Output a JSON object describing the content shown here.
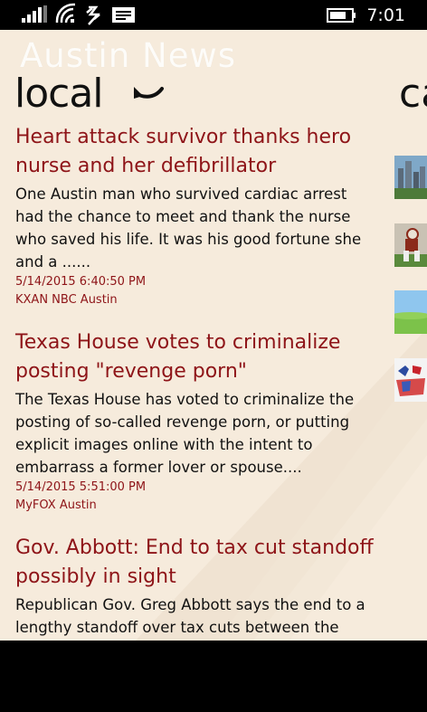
{
  "status_bar": {
    "time": "7:01"
  },
  "app": {
    "name": "Austin News"
  },
  "pivot": {
    "current": "local",
    "next_peek": "ca"
  },
  "articles": [
    {
      "headline": "Heart attack survivor thanks hero nurse and her defibrillator",
      "summary": "One Austin man who survived cardiac arrest had the chance to meet and thank the nurse who saved his life. It was his good fortune she and a ......",
      "date": "5/14/2015 6:40:50 PM",
      "source": "KXAN NBC Austin"
    },
    {
      "headline": "Texas House votes to criminalize posting \"revenge porn\"",
      "summary": "The Texas House has voted to criminalize the posting of so-called revenge porn, or putting explicit images online with the intent to embarrass a former lover or spouse....",
      "date": "5/14/2015 5:51:00 PM",
      "source": "MyFOX Austin"
    },
    {
      "headline": "Gov. Abbott: End to tax cut standoff possibly in sight",
      "summary": "Republican Gov. Greg Abbott says the end to a lengthy standoff over tax cuts between the",
      "date": "",
      "source": ""
    }
  ],
  "thumbnails": [
    {
      "icon": "city-skyline-thumbnail"
    },
    {
      "icon": "football-player-thumbnail"
    },
    {
      "icon": "green-field-thumbnail"
    },
    {
      "icon": "politics-map-thumbnail"
    }
  ],
  "colors": {
    "accent": "#8e1418",
    "background": "#f6ebdc",
    "text": "#111111"
  }
}
